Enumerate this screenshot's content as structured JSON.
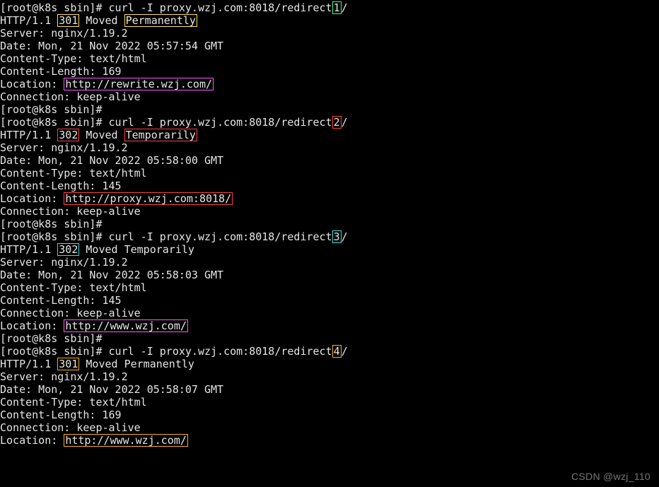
{
  "colors": {
    "green": "#39ff88",
    "yellow": "#ffe24a",
    "magenta": "#ff55ff",
    "red": "#ff4040",
    "cyan": "#3ee0e0",
    "orange": "#ffb000"
  },
  "blocks": [
    {
      "prompt": "[root@k8s sbin]# ",
      "cmd_prefix": "curl -I proxy.wzj.com:8018/redirect",
      "cmd_digit": "1",
      "digit_color": "green",
      "cmd_suffix": "/",
      "http_prefix": "HTTP/1.1 ",
      "code": "301",
      "code_color": "yellow",
      "moved_prefix": " Moved ",
      "moved_word": "Permanently",
      "moved_color": "yellow",
      "moved_boxed": true,
      "server": "Server: nginx/1.19.2",
      "date": "Date: Mon, 21 Nov 2022 05:57:54 GMT",
      "ctype": "Content-Type: text/html",
      "clen": "Content-Length: 169",
      "location_before_conn": true,
      "loc_prefix": "Location: ",
      "loc_url": "http://rewrite.wzj.com/",
      "loc_color": "magenta",
      "conn": "Connection: keep-alive"
    },
    {
      "prompt": "[root@k8s sbin]# ",
      "cmd_prefix": "curl -I proxy.wzj.com:8018/redirect",
      "cmd_digit": "2",
      "digit_color": "red",
      "cmd_suffix": "/",
      "http_prefix": "HTTP/1.1 ",
      "code": "302",
      "code_color": "red",
      "moved_prefix": " Moved ",
      "moved_word": "Temporarily",
      "moved_color": "red",
      "moved_boxed": true,
      "server": "Server: nginx/1.19.2",
      "date": "Date: Mon, 21 Nov 2022 05:58:00 GMT",
      "ctype": "Content-Type: text/html",
      "clen": "Content-Length: 145",
      "location_before_conn": true,
      "loc_prefix": "Location: ",
      "loc_url": "http://proxy.wzj.com:8018/",
      "loc_color": "red",
      "conn": "Connection: keep-alive"
    },
    {
      "prompt": "[root@k8s sbin]# ",
      "cmd_prefix": "curl -I proxy.wzj.com:8018/redirect",
      "cmd_digit": "3",
      "digit_color": "cyan",
      "cmd_suffix": "/",
      "http_prefix": "HTTP/1.1 ",
      "code": "302",
      "code_color": "cyan",
      "moved_prefix": " Moved ",
      "moved_word": "Temporarily",
      "moved_color": "",
      "moved_boxed": false,
      "server": "Server: nginx/1.19.2",
      "date": "Date: Mon, 21 Nov 2022 05:58:03 GMT",
      "ctype": "Content-Type: text/html",
      "clen": "Content-Length: 145",
      "location_before_conn": false,
      "loc_prefix": "Location: ",
      "loc_url": "http://www.wzj.com/",
      "loc_color": "magenta",
      "conn": "Connection: keep-alive"
    },
    {
      "prompt": "[root@k8s sbin]# ",
      "cmd_prefix": "curl -I proxy.wzj.com:8018/redirect",
      "cmd_digit": "4",
      "digit_color": "orange",
      "cmd_suffix": "/",
      "http_prefix": "HTTP/1.1 ",
      "code": "301",
      "code_color": "orange",
      "moved_prefix": " Moved ",
      "moved_word": "Permanently",
      "moved_color": "",
      "moved_boxed": false,
      "server": "Server: nginx/1.19.2",
      "date": "Date: Mon, 21 Nov 2022 05:58:07 GMT",
      "ctype": "Content-Type: text/html",
      "clen": "Content-Length: 169",
      "location_before_conn": false,
      "loc_prefix": "Location: ",
      "loc_url": "http://www.wzj.com/",
      "loc_color": "orange",
      "conn": "Connection: keep-alive"
    }
  ],
  "bare_prompt": "[root@k8s sbin]#",
  "watermark": "CSDN @wzj_110"
}
